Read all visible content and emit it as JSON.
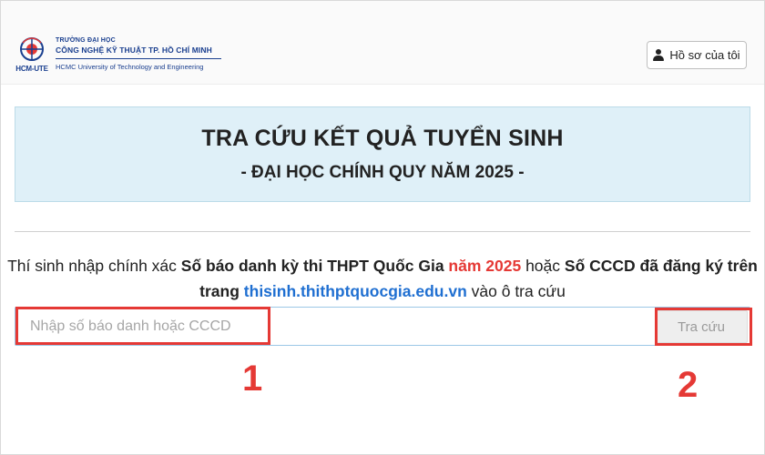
{
  "header": {
    "logo_text": "HCM-UTE",
    "school_prefix": "TRƯỜNG ĐẠI HỌC",
    "school_name": "CÔNG NGHỆ KỸ THUẬT TP. HỒ CHÍ MINH",
    "school_name_en": "HCMC University of Technology and Engineering",
    "profile_button_label": "Hồ sơ của tôi",
    "profile_icon": "user-icon"
  },
  "banner": {
    "title": "TRA CỨU KẾT QUẢ TUYỂN SINH",
    "subtitle": "-  ĐẠI HỌC CHÍNH QUY NĂM 2025  -"
  },
  "instruction": {
    "part1": "Thí sinh nhập chính xác ",
    "bold1": "Số báo danh kỳ thi THPT Quốc Gia ",
    "red": "năm 2025",
    "part2": " hoặc ",
    "bold2": "Số CCCD đã đăng ký trên trang",
    "part3": " ",
    "link": "thisinh.thithptquocgia.edu.vn",
    "part4": " vào ô tra cứu"
  },
  "search": {
    "placeholder": "Nhập số báo danh hoặc CCCD",
    "value": "",
    "button_label": "Tra cứu"
  },
  "annotations": {
    "label_1": "1",
    "label_2": "2",
    "highlight_color": "#e53935"
  },
  "colors": {
    "brand_blue": "#1a3f8f",
    "banner_bg": "#dff0f8",
    "link_blue": "#1f6fd1",
    "accent_red": "#e53935"
  }
}
